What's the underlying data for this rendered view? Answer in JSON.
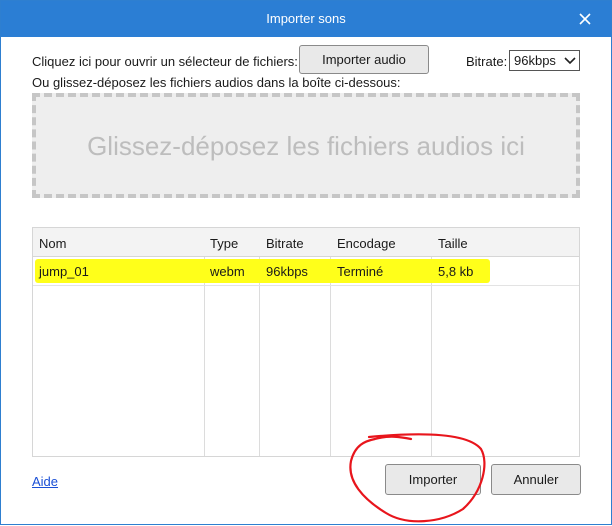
{
  "window": {
    "title": "Importer sons"
  },
  "picker": {
    "prompt": "Cliquez ici pour ouvrir un sélecteur de fichiers:",
    "import_audio_label": "Importer audio",
    "bitrate_label": "Bitrate:",
    "bitrate_value": "96kbps"
  },
  "drop": {
    "instruction": "Ou glissez-déposez les fichiers audios dans la boîte ci-dessous:",
    "zone_text": "Glissez-déposez les fichiers audios ici"
  },
  "table": {
    "headers": [
      "Nom",
      "Type",
      "Bitrate",
      "Encodage",
      "Taille"
    ],
    "rows": [
      [
        "jump_01",
        "webm",
        "96kbps",
        "Terminé",
        "5,8 kb"
      ]
    ]
  },
  "footer": {
    "help_label": "Aide",
    "import_label": "Importer",
    "cancel_label": "Annuler"
  },
  "colors": {
    "titlebar": "#2b7ed4",
    "row_highlight": "#ffff1a",
    "annotation": "#e8151c",
    "link": "#1a4fd6"
  },
  "icons": {
    "close": "close-icon",
    "dropdown": "chevron-down-icon"
  }
}
